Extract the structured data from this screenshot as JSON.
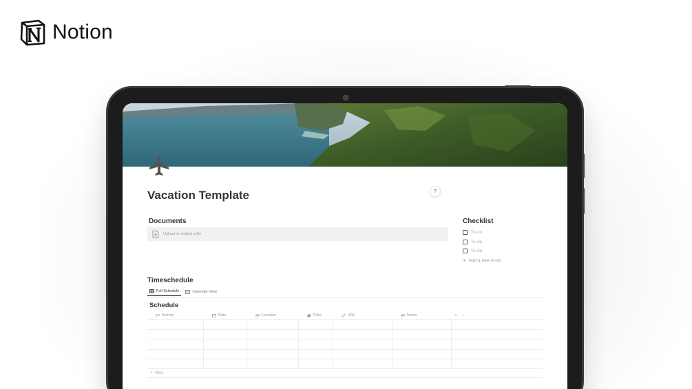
{
  "brand": {
    "name": "Notion",
    "icon": "notion-logo"
  },
  "page": {
    "icon": "airplane-icon",
    "title": "Vacation Template"
  },
  "documents": {
    "heading": "Documents",
    "upload_label": "Upload or embed a file",
    "upload_icon": "file-upload-icon"
  },
  "checklist": {
    "heading": "Checklist",
    "items": [
      "To-do",
      "To-do",
      "To-do"
    ],
    "add_label": "Add a new to-do"
  },
  "timeschedule": {
    "heading": "Timeschedule",
    "tabs": [
      {
        "label": "Full Schedule",
        "icon": "table-icon",
        "active": true
      },
      {
        "label": "Calendar View",
        "icon": "calendar-icon",
        "active": false
      }
    ],
    "database_title": "Schedule",
    "columns": [
      {
        "label": "Activity",
        "icon": "title-icon"
      },
      {
        "label": "Date",
        "icon": "calendar-icon"
      },
      {
        "label": "Location",
        "icon": "text-icon"
      },
      {
        "label": "Files",
        "icon": "files-icon"
      },
      {
        "label": "URL",
        "icon": "link-icon"
      },
      {
        "label": "Notes",
        "icon": "text-icon"
      }
    ],
    "add_column_label": "+",
    "more_label": "···",
    "rows": [
      [
        "",
        "",
        "",
        "",
        "",
        ""
      ],
      [
        "",
        "",
        "",
        "",
        "",
        ""
      ],
      [
        "",
        "",
        "",
        "",
        "",
        ""
      ],
      [
        "",
        "",
        "",
        "",
        "",
        ""
      ],
      [
        "",
        "",
        "",
        "",
        "",
        ""
      ]
    ],
    "new_row_label": "New"
  },
  "help": {
    "label": "?"
  },
  "colors": {
    "text": "#37352f",
    "muted": "#9b9a97",
    "upload_bg": "#f1f1ef",
    "device_frame": "#1c1c1c"
  }
}
